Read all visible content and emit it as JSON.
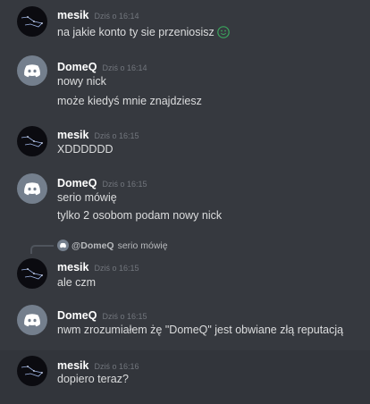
{
  "colors": {
    "background": "#36393f",
    "hover_background": "#32353b",
    "username": "#ffffff",
    "timestamp": "#72767d",
    "message_text": "#dcddde",
    "discord_avatar": "#747f8d",
    "dark_avatar": "#0b0b10"
  },
  "groups": [
    {
      "author": "mesik",
      "avatar": "constellation-avatar",
      "timestamp": "Dziś o 16:14",
      "lines": [
        "na jakie konto ty sie przeniosisz"
      ],
      "emoji": "slight-smile-emoji"
    },
    {
      "author": "DomeQ",
      "avatar": "discord-logo-avatar",
      "timestamp": "Dziś o 16:14",
      "lines": [
        "nowy nick",
        "może kiedyś mnie znajdziesz"
      ]
    },
    {
      "author": "mesik",
      "avatar": "constellation-avatar",
      "timestamp": "Dziś o 16:15",
      "lines": [
        "XDDDDDD"
      ]
    },
    {
      "author": "DomeQ",
      "avatar": "discord-logo-avatar",
      "timestamp": "Dziś o 16:15",
      "lines": [
        "serio mówię",
        "tylko 2 osobom podam nowy nick"
      ]
    },
    {
      "author": "mesik",
      "avatar": "constellation-avatar",
      "timestamp": "Dziś o 16:15",
      "lines": [
        "ale czm"
      ],
      "reply": {
        "author": "@DomeQ",
        "text": "serio mówię"
      }
    },
    {
      "author": "DomeQ",
      "avatar": "discord-logo-avatar",
      "timestamp": "Dziś o 16:15",
      "lines": [
        "nwm zrozumiałem żę \"DomeQ\" jest obwiane złą reputacją"
      ]
    },
    {
      "author": "mesik",
      "avatar": "constellation-avatar",
      "timestamp": "Dziś o 16:16",
      "lines": [
        "dopiero teraz?"
      ]
    }
  ]
}
